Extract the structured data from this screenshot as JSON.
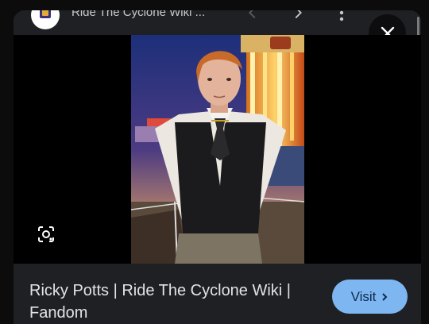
{
  "header": {
    "site_title": "Ride The Cyclone Wiki ...",
    "icons": {
      "site": "site-favicon-icon",
      "back": "chevron-left-icon",
      "forward": "chevron-right-icon",
      "more": "more-vert-icon",
      "close": "close-icon"
    }
  },
  "image": {
    "alt": "Ricky Potts | Ride The Cyclone Wiki | Fandom",
    "lens_icon": "google-lens-icon"
  },
  "result": {
    "caption": "Ricky Potts | Ride The Cyclone Wiki | Fandom",
    "visit_label": "Visit"
  },
  "colors": {
    "panel": "#1f2023",
    "visit_button": "#7eb6f2",
    "page": "#0c0c0d"
  }
}
